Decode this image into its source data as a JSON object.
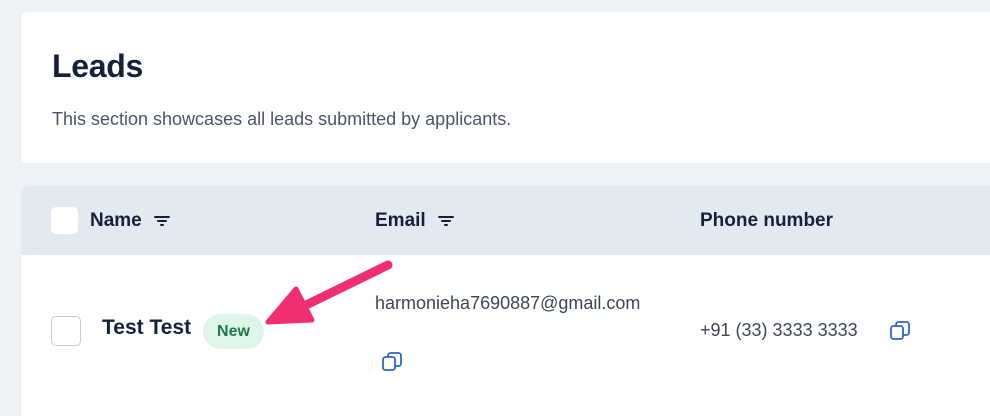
{
  "page": {
    "title": "Leads",
    "description": "This section showcases all leads submitted by applicants."
  },
  "table": {
    "columns": [
      {
        "label": "Name",
        "filterable": true
      },
      {
        "label": "Email",
        "filterable": true
      },
      {
        "label": "Phone number",
        "filterable": false
      }
    ],
    "rows": [
      {
        "name": "Test Test",
        "badge": "New",
        "email": "harmonieha7690887@gmail.com",
        "phone": "+91 (33) 3333 3333"
      }
    ]
  },
  "colors": {
    "badge_bg": "#dff5ea",
    "badge_text": "#1d7a4a",
    "annotation_arrow": "#f0306e",
    "copy_icon": "#2f64c8"
  },
  "icons": [
    "filter-icon",
    "copy-icon",
    "annotation-arrow"
  ]
}
